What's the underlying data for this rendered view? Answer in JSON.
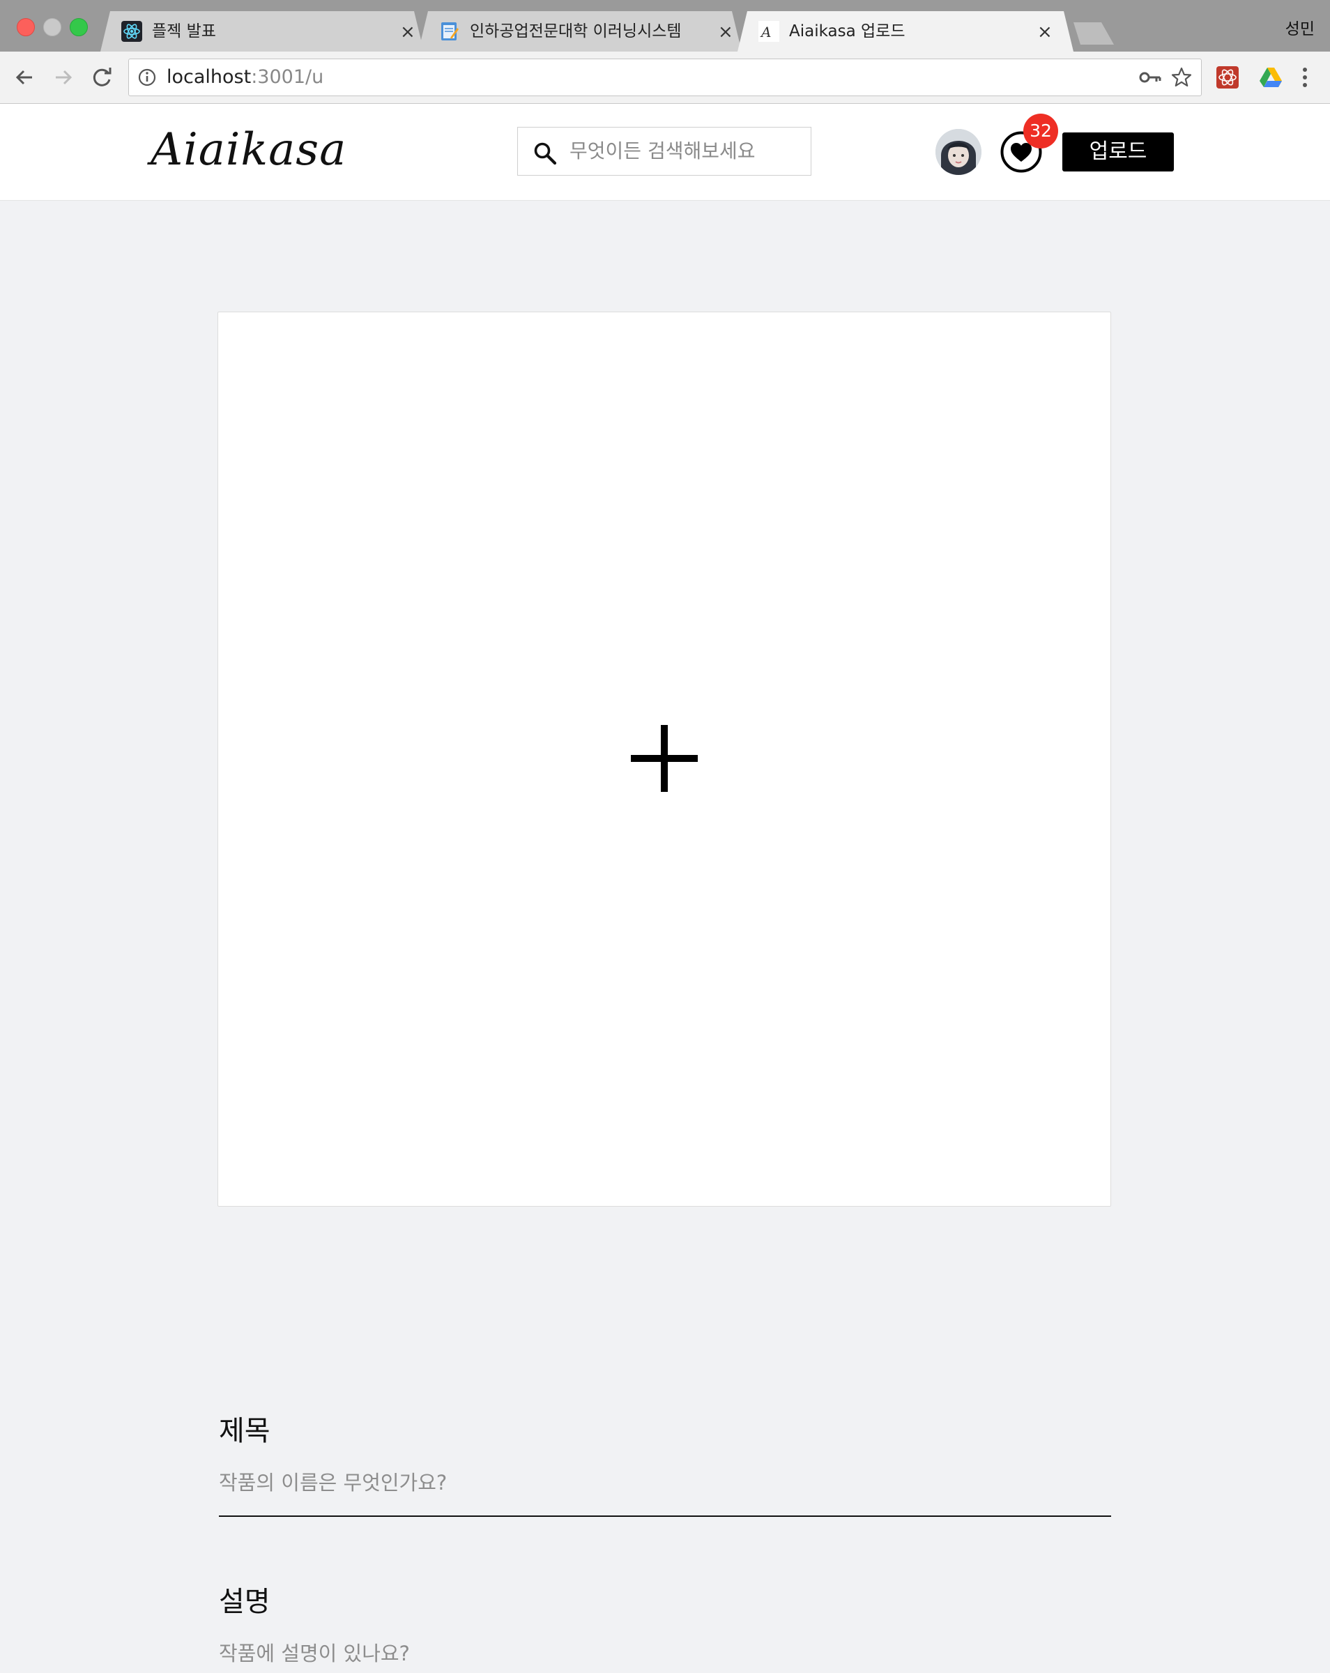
{
  "browser": {
    "tabs": [
      {
        "title": "플젝 발표",
        "icon": "react-icon",
        "active": false
      },
      {
        "title": "인하공업전문대학 이러닝시스템",
        "icon": "notepad-icon",
        "active": false
      },
      {
        "title": "Aiaikasa 업로드",
        "icon": "aiaikasa-favicon",
        "active": true
      }
    ],
    "profile_name": "성민",
    "url_host": "localhost",
    "url_rest": ":3001/u"
  },
  "header": {
    "logo": "Aiaikasa",
    "search_placeholder": "무엇이든 검색해보세요",
    "likes_count": "32",
    "upload_label": "업로드"
  },
  "upload": {
    "dropzone_icon": "plus-icon"
  },
  "form": {
    "title_label": "제목",
    "title_placeholder": "작품의 이름은 무엇인가요?",
    "description_label": "설명",
    "description_placeholder": "작품에 설명이 있나요?"
  },
  "colors": {
    "page_bg": "#f1f2f4",
    "badge": "#ee2e24",
    "upload_button": "#000000"
  }
}
